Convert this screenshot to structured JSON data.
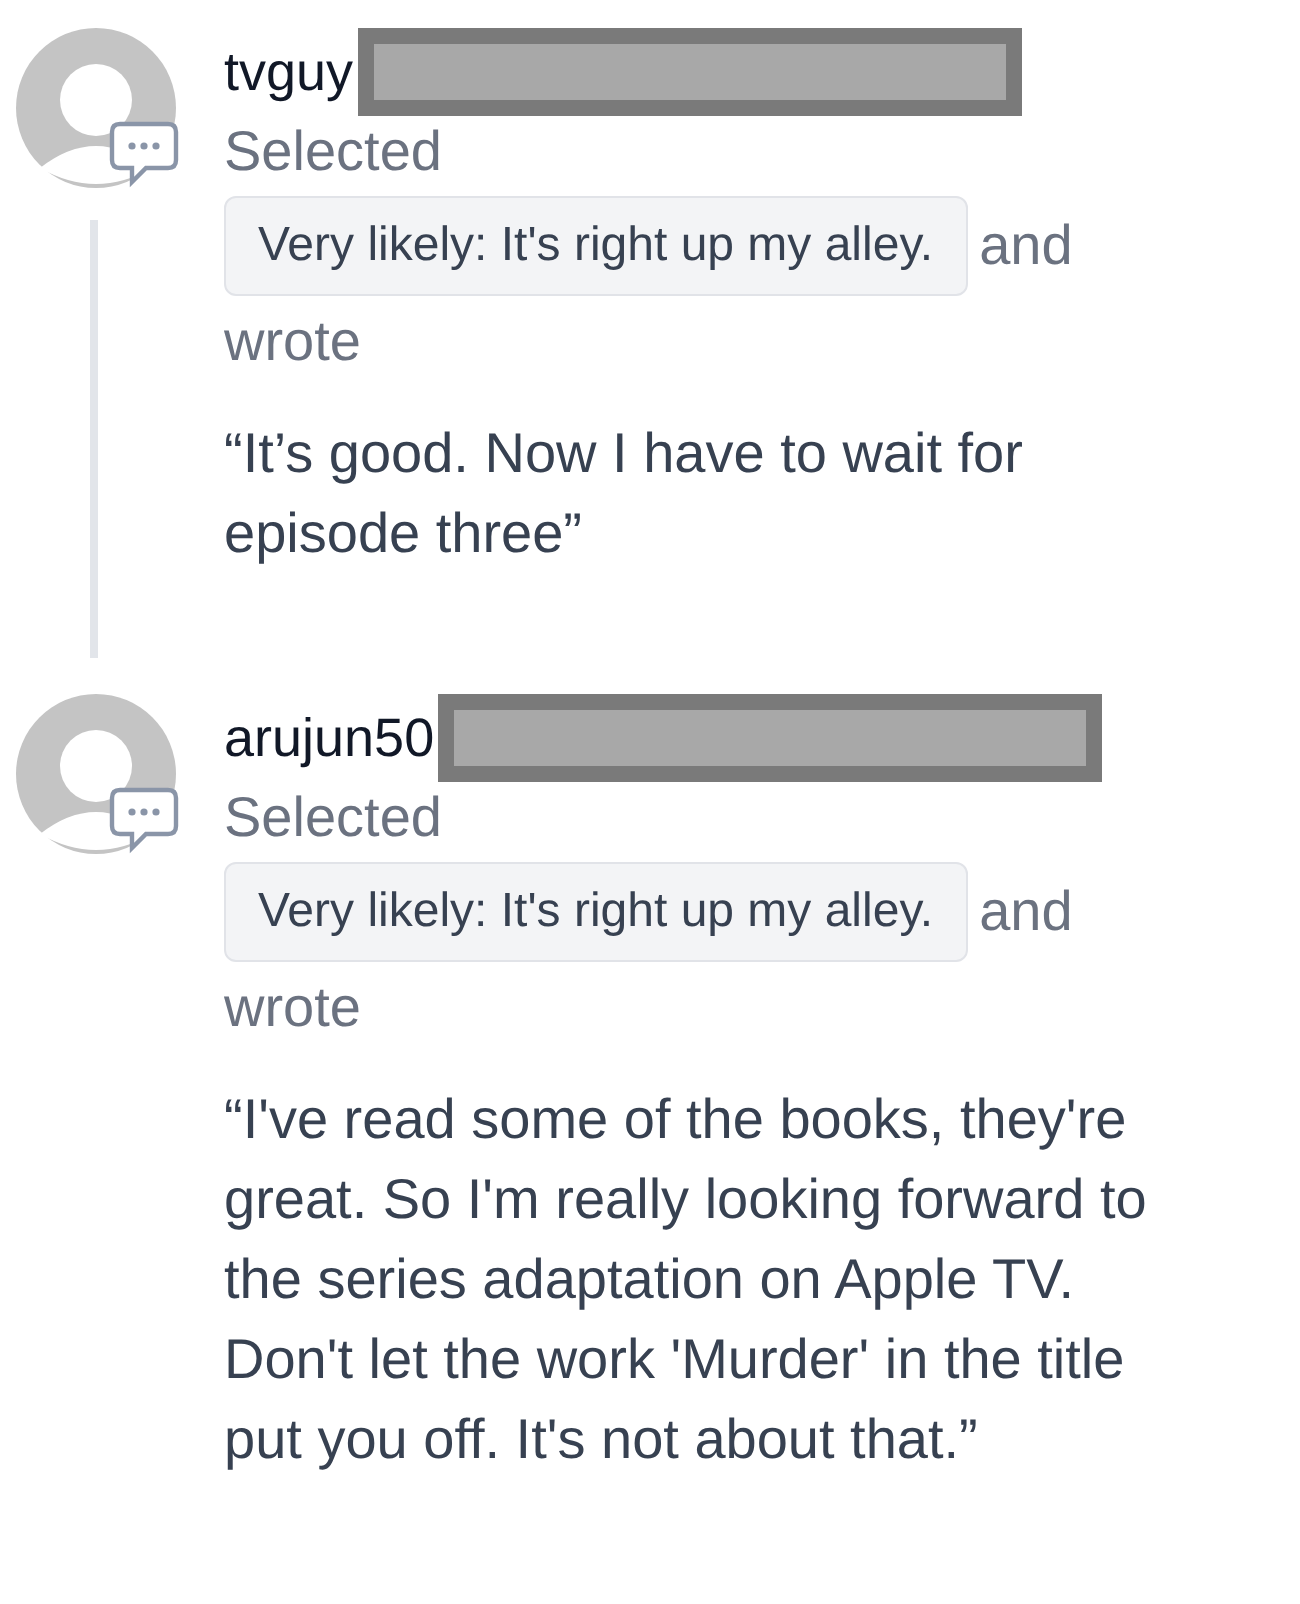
{
  "entries": [
    {
      "username": "tvguy",
      "redacted": true,
      "action": "Selected",
      "choice": "Very likely: It's right up my alley.",
      "connector": [
        "and",
        "wrote"
      ],
      "quote": "“It’s good. Now I have to wait for episode three”",
      "thread_line": true
    },
    {
      "username": "arujun50",
      "redacted": true,
      "action": "Selected",
      "choice": "Very likely: It's right up my alley.",
      "connector": [
        "and",
        "wrote"
      ],
      "quote": "“I've read some of the books, they're great. So I'm really looking forward to the series adaptation on Apple TV. Don't let the work 'Murder' in the title put you off. It's not about that.”",
      "thread_line": false
    }
  ]
}
